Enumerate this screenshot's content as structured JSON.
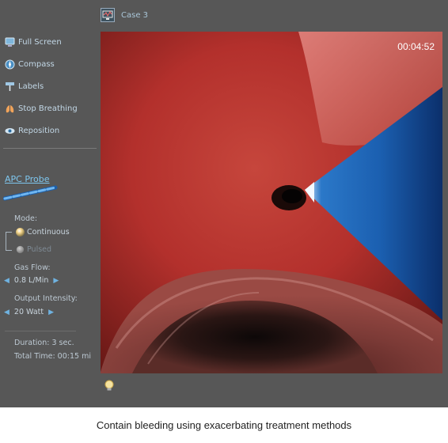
{
  "case": {
    "title": "Case 3",
    "icon": "case-monitor-icon"
  },
  "toolbar": {
    "items": [
      {
        "label": "Full Screen",
        "icon": "monitor-icon"
      },
      {
        "label": "Compass",
        "icon": "compass-icon"
      },
      {
        "label": "Labels",
        "icon": "label-pin-icon"
      },
      {
        "label": "Stop Breathing",
        "icon": "lungs-icon"
      },
      {
        "label": "Reposition",
        "icon": "eye-icon"
      }
    ]
  },
  "probe": {
    "title": "APC Probe",
    "mode_label": "Mode:",
    "modes": [
      {
        "label": "Continuous",
        "selected": true
      },
      {
        "label": "Pulsed",
        "selected": false
      }
    ],
    "gas_flow_label": "Gas Flow:",
    "gas_flow_value": "0.8 L/Min",
    "output_label": "Output Intensity:",
    "output_value": "20 Watt",
    "duration": "Duration:  3 sec.",
    "total_time": "Total Time: 00:15 mi"
  },
  "viewport": {
    "timer": "00:04:52"
  },
  "hint": {
    "icon": "lightbulb-icon"
  },
  "caption": "Contain bleeding using exacerbating treatment methods",
  "colors": {
    "accent": "#7ec6ee",
    "background": "#575757",
    "tissue": "#b8302c",
    "probe": "#1f5fa8"
  }
}
